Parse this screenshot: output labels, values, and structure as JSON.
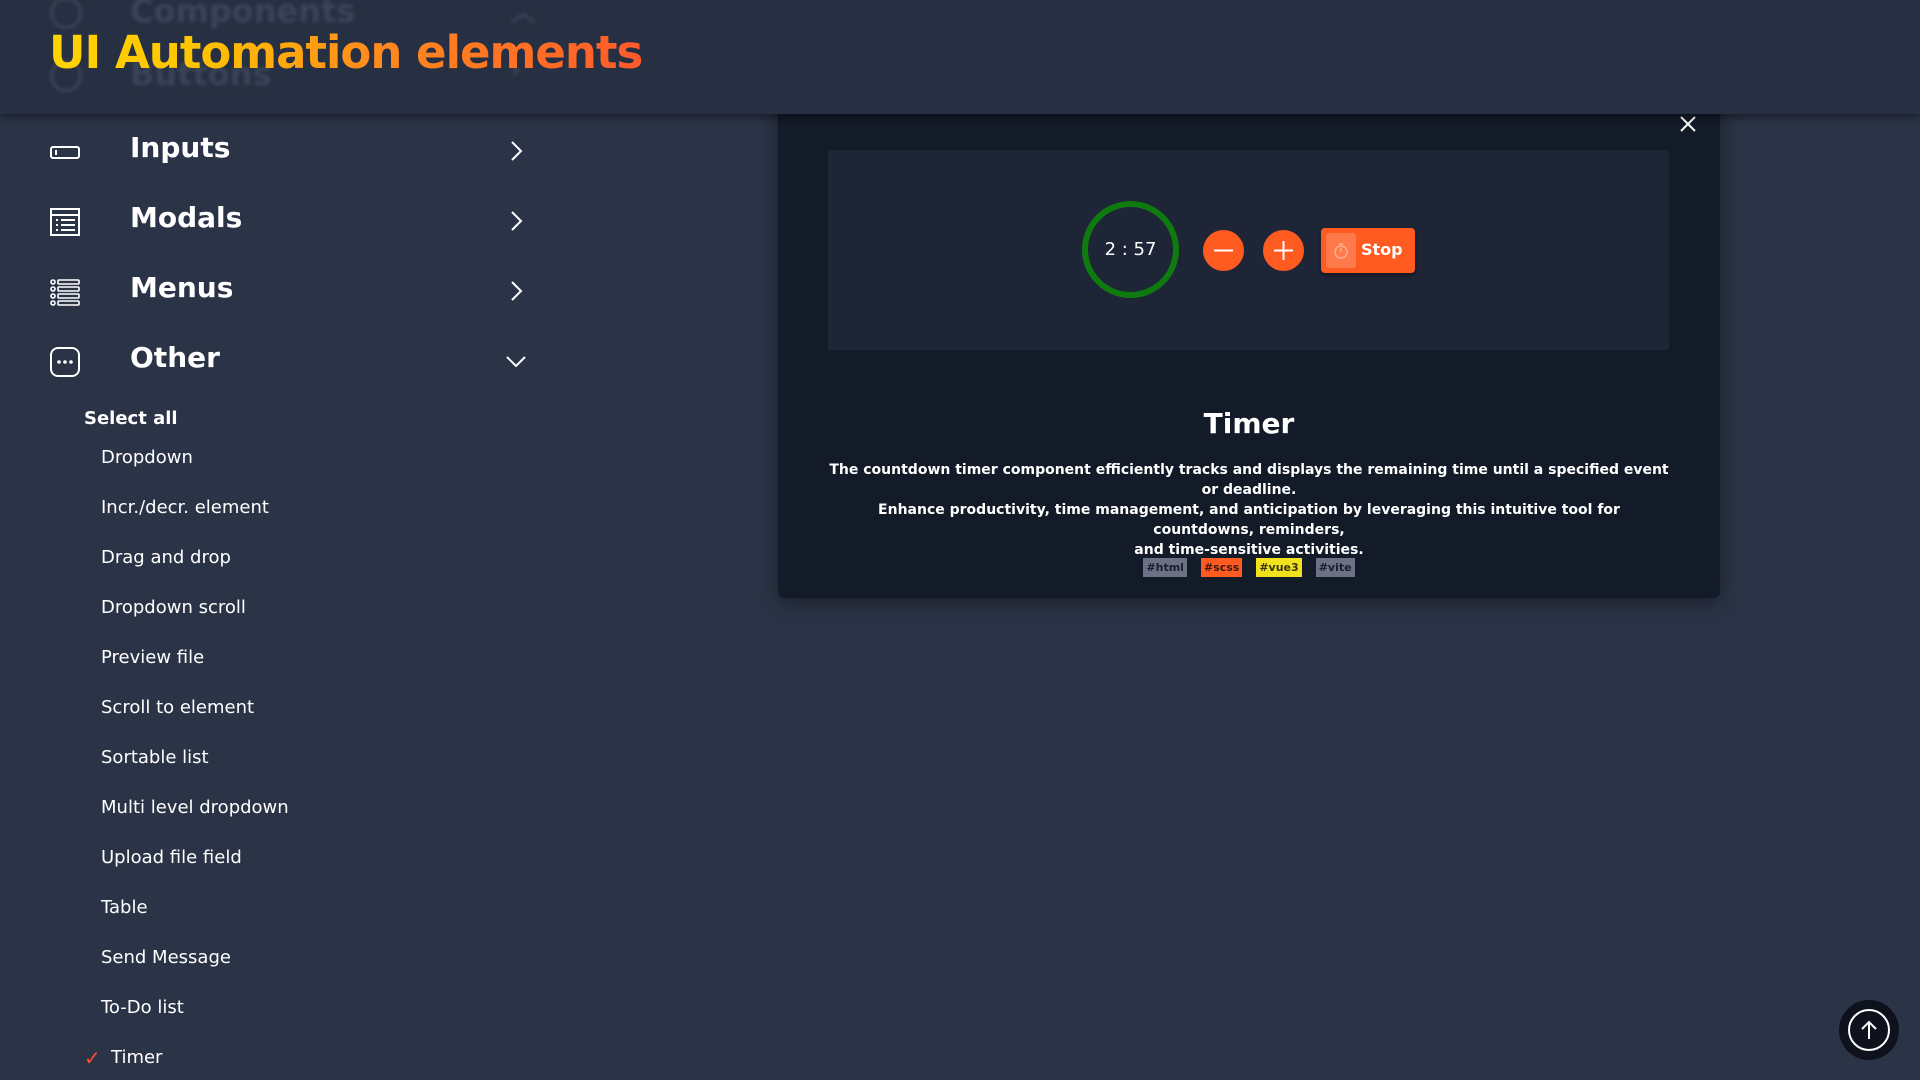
{
  "header": {
    "logo": "UI Automation elements",
    "ghost_top": "Components",
    "ghost_second": "Buttons"
  },
  "sidebar": {
    "categories": [
      {
        "label": "Inputs",
        "icon": "input-field-icon"
      },
      {
        "label": "Modals",
        "icon": "modal-list-icon"
      },
      {
        "label": "Menus",
        "icon": "menu-list-icon"
      },
      {
        "label": "Other",
        "icon": "more-dots-icon"
      }
    ],
    "select_all": "Select all",
    "items": [
      "Dropdown",
      "Incr./decr. element",
      "Drag and drop",
      "Dropdown scroll",
      "Preview file",
      "Scroll to element",
      "Sortable list",
      "Multi level dropdown",
      "Upload file field",
      "Table",
      "Send Message",
      "To-Do list",
      "Timer"
    ],
    "active_item": "Timer",
    "check_mark": "✓"
  },
  "card": {
    "timer_value": "2 : 57",
    "stop_label": "Stop",
    "title": "Timer",
    "description_line1": "The countdown timer component efficiently tracks and displays the remaining time until a specified event or deadline.",
    "description_line2": "Enhance productivity, time management, and anticipation by leveraging this intuitive tool for countdowns, reminders,",
    "description_line3": "and time-sensitive activities.",
    "tags": [
      {
        "label": "#html",
        "bg": "#6b7285",
        "fg": "#1a1f2c"
      },
      {
        "label": "#scss",
        "bg": "#ff5a20",
        "fg": "#3a1a10"
      },
      {
        "label": "#vue3",
        "bg": "#f2e11d",
        "fg": "#3a3510"
      },
      {
        "label": "#vite",
        "bg": "#6b7285",
        "fg": "#1a1f2c"
      }
    ]
  },
  "colors": {
    "accent": "#ff5a20",
    "timer_ring": "#0f7b0f",
    "page_bg": "#2b3447",
    "card_bg": "#131a28"
  }
}
